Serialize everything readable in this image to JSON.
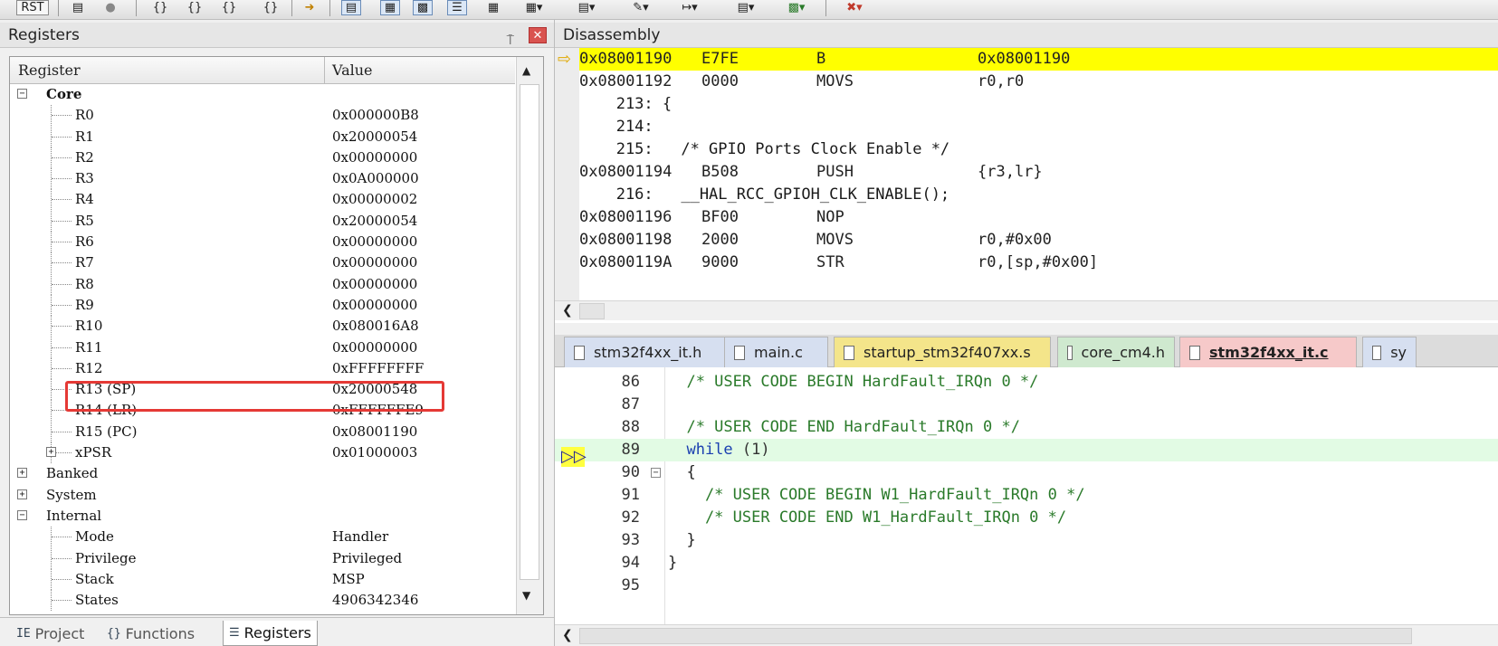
{
  "toolbar": {
    "rst_label": "RST"
  },
  "registers_panel": {
    "title": "Registers",
    "pin_glyph": "⍑",
    "close_glyph": "✕",
    "columns": {
      "register": "Register",
      "value": "Value"
    },
    "core_label": "Core",
    "core_registers": [
      {
        "name": "R0",
        "value": "0x000000B8"
      },
      {
        "name": "R1",
        "value": "0x20000054"
      },
      {
        "name": "R2",
        "value": "0x00000000"
      },
      {
        "name": "R3",
        "value": "0x0A000000"
      },
      {
        "name": "R4",
        "value": "0x00000002"
      },
      {
        "name": "R5",
        "value": "0x20000054"
      },
      {
        "name": "R6",
        "value": "0x00000000"
      },
      {
        "name": "R7",
        "value": "0x00000000"
      },
      {
        "name": "R8",
        "value": "0x00000000"
      },
      {
        "name": "R9",
        "value": "0x00000000"
      },
      {
        "name": "R10",
        "value": "0x080016A8"
      },
      {
        "name": "R11",
        "value": "0x00000000"
      },
      {
        "name": "R12",
        "value": "0xFFFFFFFF"
      },
      {
        "name": "R13 (SP)",
        "value": "0x20000548"
      },
      {
        "name": "R14 (LR)",
        "value": "0xFFFFFFE9"
      },
      {
        "name": "R15 (PC)",
        "value": "0x08001190"
      },
      {
        "name": "xPSR",
        "value": "0x01000003"
      }
    ],
    "groups": [
      "Banked",
      "System",
      "Internal"
    ],
    "internal_items": [
      {
        "name": "Mode",
        "value": "Handler"
      },
      {
        "name": "Privilege",
        "value": "Privileged"
      },
      {
        "name": "Stack",
        "value": "MSP"
      },
      {
        "name": "States",
        "value": "4906342346"
      }
    ],
    "highlight_color": "#e53935"
  },
  "bottom_tabs": [
    {
      "label": "Project",
      "icon": "project-icon",
      "glyph": "IE"
    },
    {
      "label": "Functions",
      "icon": "functions-icon",
      "glyph": "{}"
    },
    {
      "label": "Registers",
      "icon": "registers-icon",
      "glyph": "☰"
    }
  ],
  "disassembly": {
    "title": "Disassembly",
    "lines": [
      {
        "addr": "0x08001190",
        "hex": "E7FE",
        "mnem": "B",
        "ops": "0x08001190",
        "current": true
      },
      {
        "addr": "0x08001192",
        "hex": "0000",
        "mnem": "MOVS",
        "ops": "r0,r0"
      },
      {
        "src": "   213: {"
      },
      {
        "src": "   214:"
      },
      {
        "src": "   215:   /* GPIO Ports Clock Enable */"
      },
      {
        "addr": "0x08001194",
        "hex": "B508",
        "mnem": "PUSH",
        "ops": "{r3,lr}"
      },
      {
        "src": "   216:   __HAL_RCC_GPIOH_CLK_ENABLE();"
      },
      {
        "addr": "0x08001196",
        "hex": "BF00",
        "mnem": "NOP",
        "ops": ""
      },
      {
        "addr": "0x08001198",
        "hex": "2000",
        "mnem": "MOVS",
        "ops": "r0,#0x00"
      },
      {
        "addr": "0x0800119A",
        "hex": "9000",
        "mnem": "STR",
        "ops": "r0,[sp,#0x00]"
      }
    ],
    "current_color": "#ffff00"
  },
  "file_tabs": [
    {
      "label": "stm32f4xx_it.h",
      "color": "#d6dff0",
      "active": false
    },
    {
      "label": "main.c",
      "color": "#d6dff0",
      "active": false
    },
    {
      "label": "startup_stm32f407xx.s",
      "color": "#f4e58a",
      "active": false
    },
    {
      "label": "core_cm4.h",
      "color": "#cfe9cf",
      "active": false
    },
    {
      "label": "stm32f4xx_it.c",
      "color": "#f6c9c9",
      "active": true
    },
    {
      "label": "sy",
      "color": "#d6dff0",
      "active": false
    }
  ],
  "code": {
    "lines": [
      {
        "num": "86",
        "text": "  /* USER CODE BEGIN HardFault_IRQn 0 */"
      },
      {
        "num": "87",
        "text": ""
      },
      {
        "num": "88",
        "text": "  /* USER CODE END HardFault_IRQn 0 */"
      },
      {
        "num": "89",
        "kw": "  while ",
        "text": "(1)",
        "current": true
      },
      {
        "num": "90",
        "text": "  {",
        "fold": true
      },
      {
        "num": "91",
        "text": "    /* USER CODE BEGIN W1_HardFault_IRQn 0 */"
      },
      {
        "num": "92",
        "text": "    /* USER CODE END W1_HardFault_IRQn 0 */"
      },
      {
        "num": "93",
        "text": "  }"
      },
      {
        "num": "94",
        "text": "}"
      },
      {
        "num": "95",
        "text": ""
      }
    ]
  }
}
